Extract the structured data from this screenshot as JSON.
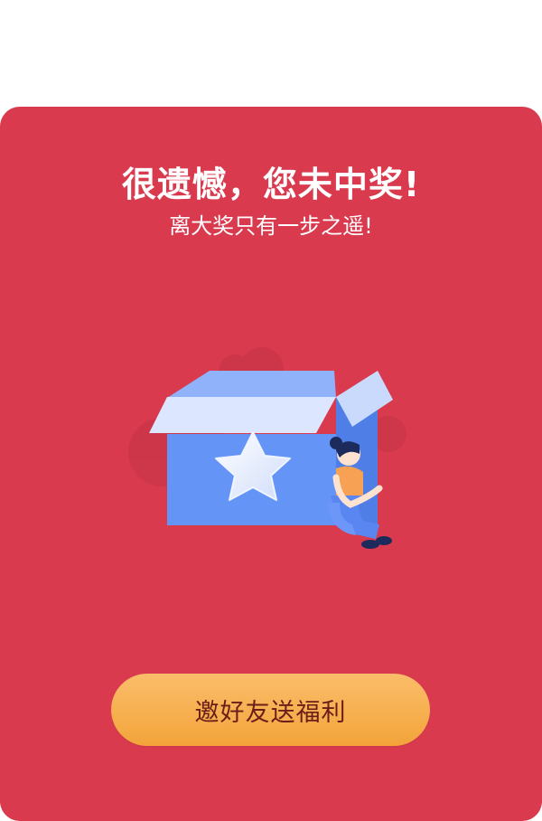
{
  "result": {
    "title": "很遗憾，您未中奖!",
    "subtitle": "离大奖只有一步之遥!"
  },
  "illustration": {
    "icons": [
      "gift-box-icon",
      "star-icon",
      "sad-girl-icon"
    ]
  },
  "cta": {
    "label": "邀好友送福利"
  },
  "colors": {
    "card_bg": "#d93a4e",
    "button_top": "#fbbd6a",
    "button_bottom": "#f3a43a",
    "button_text": "#6b1d18",
    "box_blue": "#5b8ff5"
  }
}
